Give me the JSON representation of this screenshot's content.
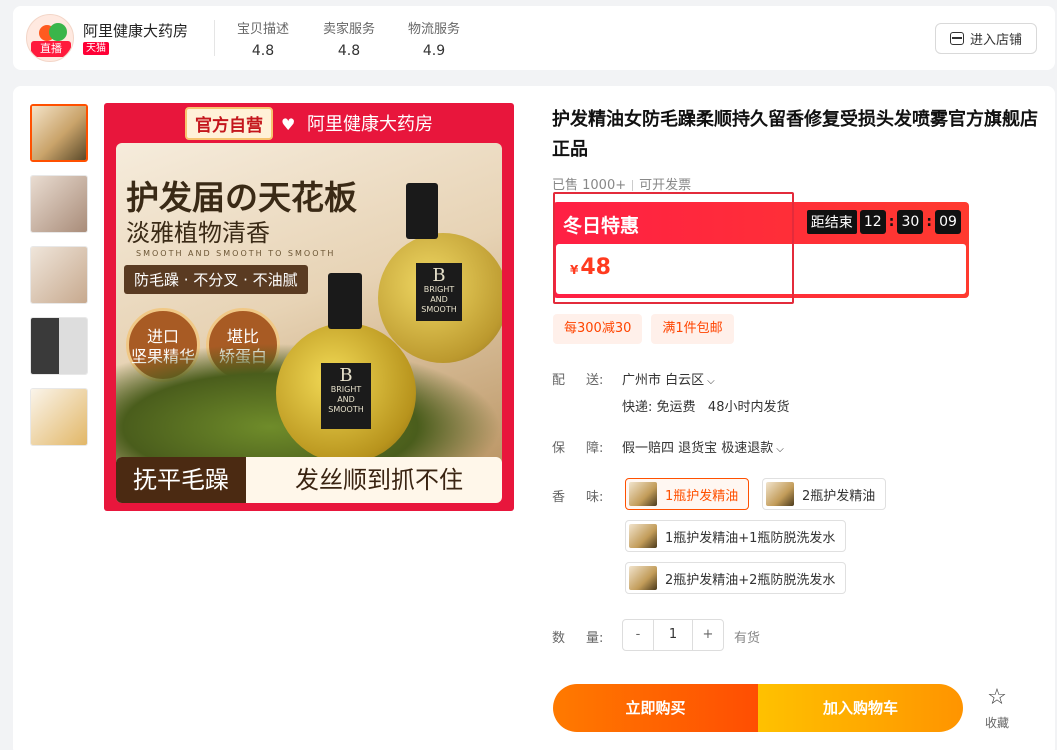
{
  "shop": {
    "name": "阿里健康大药房",
    "badge": "天猫",
    "live_label": "直播",
    "scores": [
      {
        "label": "宝贝描述",
        "value": "4.8"
      },
      {
        "label": "卖家服务",
        "value": "4.8"
      },
      {
        "label": "物流服务",
        "value": "4.9"
      }
    ],
    "enter_store": "进入店铺"
  },
  "hero": {
    "official": "官方自营",
    "shop_name": "阿里健康大药房",
    "title": "护发届の天花板",
    "subtitle": "淡雅植物清香",
    "english": "SMOOTH AND SMOOTH TO SMOOTH",
    "tags": "防毛躁 · 不分叉 · 不油腻",
    "seal1": "进口\n坚果精华",
    "seal2": "堪比\n矫蛋白",
    "bottle_letter": "B",
    "bottle_text": "BRIGHT AND SMOOTH",
    "bottom_left": "抚平毛躁",
    "bottom_right": "发丝顺到抓不住"
  },
  "product": {
    "title": "护发精油女防毛躁柔顺持久留香修复受损头发喷雾官方旗舰店正品",
    "sold": "已售 1000+",
    "invoice": "可开发票"
  },
  "promo": {
    "label": "冬日特惠",
    "countdown_label": "距结束",
    "hours": "12",
    "minutes": "30",
    "seconds": "09",
    "currency": "¥",
    "price": "48"
  },
  "coupons": [
    "每300减30",
    "满1件包邮"
  ],
  "delivery": {
    "label": "配",
    "label2": "送:",
    "location": "广州市 白云区",
    "shipping": "快递: 免运费",
    "ship_time": "48小时内发货"
  },
  "guarantee": {
    "label": "保",
    "label2": "障:",
    "value": "假一赔四 退货宝 极速退款"
  },
  "scent": {
    "label": "香",
    "label2": "味:",
    "options": [
      "1瓶护发精油",
      "2瓶护发精油",
      "1瓶护发精油+1瓶防脱洗发水",
      "2瓶护发精油+2瓶防脱洗发水"
    ]
  },
  "quantity": {
    "label": "数",
    "label2": "量:",
    "minus": "-",
    "value": "1",
    "plus": "+",
    "stock": "有货"
  },
  "actions": {
    "buy": "立即购买",
    "cart": "加入购物车",
    "favorite": "收藏"
  }
}
